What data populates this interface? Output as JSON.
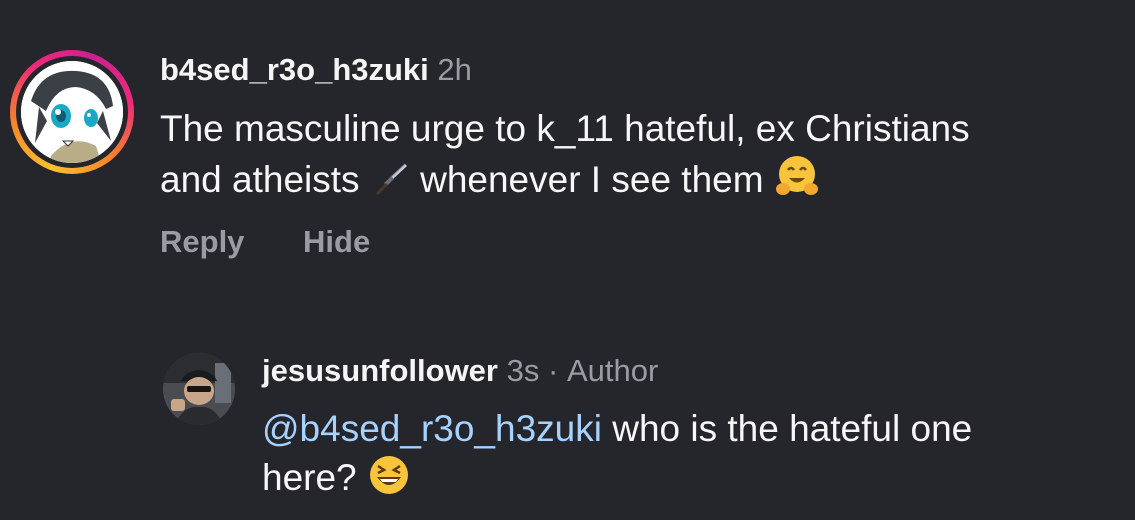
{
  "comment": {
    "username": "b4sed_r3o_h3zuki",
    "time": "2h",
    "text_line1": "The masculine urge to k_11 hateful, ex Christians",
    "text_line2_a": "and atheists",
    "text_line2_b": "whenever I see them",
    "actions": {
      "reply_label": "Reply",
      "hide_label": "Hide"
    }
  },
  "reply": {
    "username": "jesusunfollower",
    "time": "3s",
    "separator": "·",
    "author_label": "Author",
    "mention": "@b4sed_r3o_h3zuki",
    "text_a": "who is the hateful one",
    "text_b": "here?"
  },
  "icons": {
    "dagger": "dagger-emoji",
    "hug": "hugging-face-emoji",
    "laugh": "grinning-squinting-face-emoji"
  }
}
